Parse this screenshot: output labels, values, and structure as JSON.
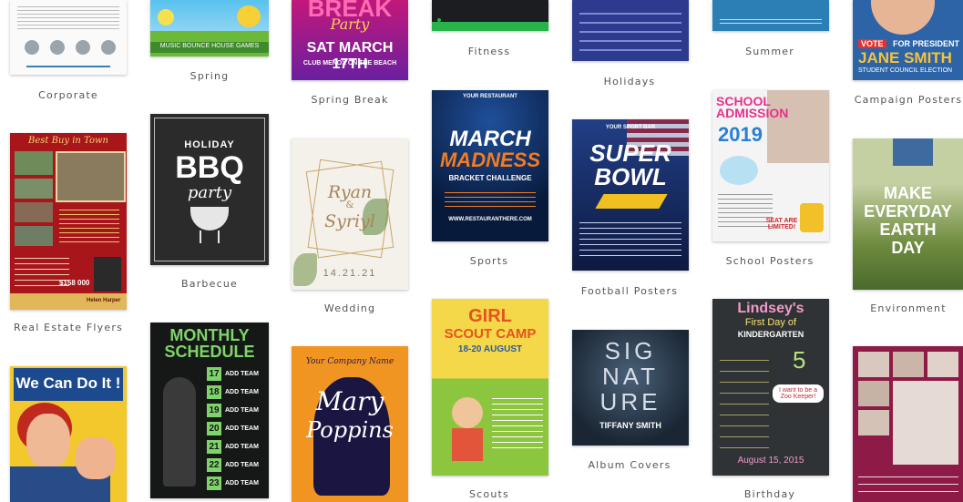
{
  "gallery": {
    "categories": {
      "corporate": "Corporate",
      "spring": "Spring",
      "spring_break": "Spring Break",
      "fitness": "Fitness",
      "holidays": "Holidays",
      "summer": "Summer",
      "campaign": "Campaign Posters",
      "real_estate": "Real Estate Flyers",
      "barbecue": "Barbecue",
      "wedding": "Wedding",
      "sports": "Sports",
      "football": "Football Posters",
      "school": "School Posters",
      "environment": "Environment",
      "scouts": "Scouts",
      "album": "Album Covers",
      "birthday": "Birthday"
    },
    "posters": {
      "spring_line": "MUSIC BOUNCE HOUSE GAMES",
      "break_word": "BREAK",
      "break_party": "Party",
      "break_date": "SAT MARCH 17TH",
      "break_club": "CLUB MENOX ON THE BEACH",
      "vote": "VOTE",
      "for_president": "FOR PRESIDENT",
      "jane": "JANE SMITH",
      "student_council": "STUDENT COUNCIL ELECTION",
      "best_buy": "Best Buy in Town",
      "realtor": "Helen Harper",
      "price": "$158 000",
      "holiday": "HOLIDAY",
      "bbq": "BBQ",
      "party": "party",
      "ryan": "Ryan",
      "and": "&",
      "syriyl": "Syriyl",
      "wedding_date": "14.21.21",
      "your_restaurant": "YOUR RESTAURANT",
      "march": "MARCH",
      "madness": "MADNESS",
      "bracket": "BRACKET CHALLENGE",
      "restaurant_url": "WWW.RESTAURANTHERE.COM",
      "sport_bar": "YOUR SPORT BAR",
      "super": "SUPER",
      "bowl": "BOWL",
      "school_admission": "SCHOOL ADMISSION",
      "year": "2019",
      "seat": "SEAT ARE LIMITED!",
      "make": "MAKE",
      "everyday": "EVERYDAY",
      "earth": "EARTH",
      "day": "DAY",
      "can_do": "We Can Do It !",
      "monthly": "MONTHLY",
      "schedule": "SCHEDULE",
      "add_team": "ADD TEAM",
      "company_name": "Your Company Name",
      "mary": "Mary",
      "poppins": "Poppins",
      "girl": "GIRL",
      "scout_camp": "SCOUT CAMP",
      "camp_dates": "18-20 AUGUST",
      "sig": "SIG",
      "nat": "NAT",
      "ure": "URE",
      "tiffany": "TIFFANY SMITH",
      "lindsey": "Lindsey's",
      "first_day": "First Day of",
      "kindergarten": "KINDERGARTEN",
      "age_num": "5",
      "birthday_date": "August 15, 2015",
      "spaceship": "I want to be a Zoo Keeper!"
    },
    "schedule_numbers": [
      "17",
      "18",
      "19",
      "20",
      "21",
      "22",
      "23"
    ]
  }
}
